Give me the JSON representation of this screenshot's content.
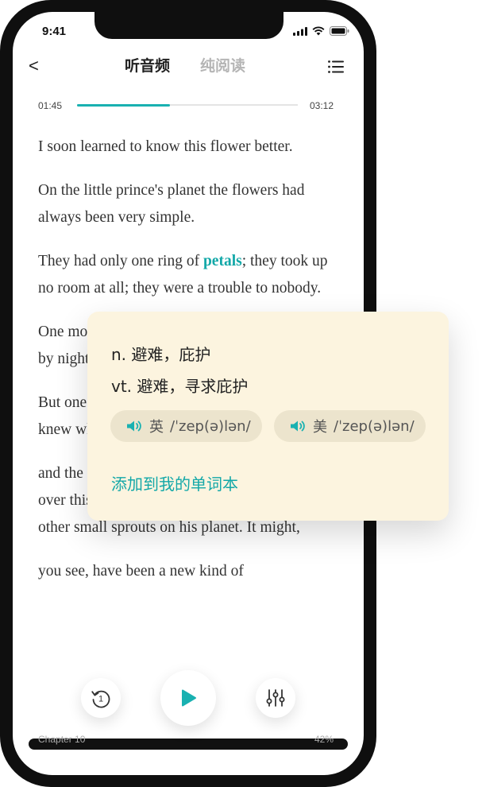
{
  "status_bar": {
    "time": "9:41"
  },
  "header": {
    "back_icon": "chevron-left-icon",
    "back_glyph": "<",
    "tabs": [
      {
        "label": "听音频",
        "active": true
      },
      {
        "label": "纯阅读",
        "active": false
      }
    ],
    "menu_icon": "list-menu-icon"
  },
  "player": {
    "current_time": "01:45",
    "total_time": "03:12",
    "progress_fraction": 0.42
  },
  "reader": {
    "paragraphs": [
      {
        "text": "I soon learned to know this flower better."
      },
      {
        "text": "On the little prince's planet the flowers had always been very simple."
      },
      {
        "text_before": "They had only one ring of ",
        "highlight": "petals",
        "text_after": "; they took up no room at all; they were a trouble to nobody."
      },
      {
        "text": "One morning they would appear in the grass, and by night they would have faded peacefully away."
      },
      {
        "text": "But one day, from a seed blown from no one knew where, a new flower had come up;"
      },
      {
        "text": "and the little prince had watched very closely over this small sprout which was not like any other small sprouts on his planet. It might,"
      },
      {
        "text": "you see, have been a new kind of"
      }
    ],
    "highlight_color": "#13a8a8"
  },
  "footer": {
    "chapter": "Chapter 10",
    "percent": "42%"
  },
  "controls": {
    "replay_icon": "replay-15-icon",
    "replay_number": "1",
    "play_icon": "play-icon",
    "settings_icon": "equalizer-icon"
  },
  "popup": {
    "definitions": [
      {
        "text": "n. 避难，庇护"
      },
      {
        "text": "vt. 避难，寻求庇护"
      }
    ],
    "pronunciations": [
      {
        "region": "英",
        "ipa": "/ˈzep(ə)lən/",
        "icon": "speaker-icon"
      },
      {
        "region": "美",
        "ipa": "/ˈzep(ə)lən/",
        "icon": "speaker-icon"
      }
    ],
    "add_to_wordbook": "添加到我的单词本",
    "accent_color": "#13a8a8",
    "background_color": "#fcf4df"
  }
}
